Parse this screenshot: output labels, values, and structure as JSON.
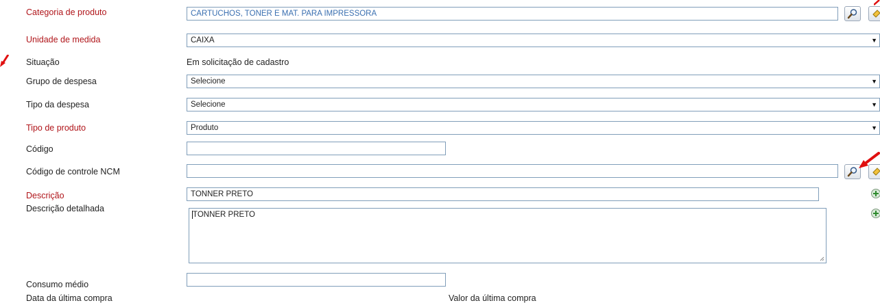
{
  "form": {
    "categoria": {
      "label": "Categoria de produto",
      "value": "CARTUCHOS, TONER E MAT. PARA IMPRESSORA"
    },
    "unidade": {
      "label": "Unidade de medida",
      "value": "CAIXA"
    },
    "situacao": {
      "label": "Situação",
      "value": "Em solicitação de cadastro"
    },
    "grupo": {
      "label": "Grupo de despesa",
      "value": "Selecione"
    },
    "tipo_despesa": {
      "label": "Tipo da despesa",
      "value": "Selecione"
    },
    "tipo_produto": {
      "label": "Tipo de produto",
      "value": "Produto"
    },
    "codigo": {
      "label": "Código",
      "value": ""
    },
    "ncm": {
      "label": "Código de controle NCM",
      "value": ""
    },
    "descricao": {
      "label": "Descrição",
      "value": "TONNER PRETO"
    },
    "descricao_detalhada": {
      "label": "Descrição detalhada",
      "value": "TONNER PRETO"
    },
    "consumo": {
      "label": "Consumo médio",
      "value": ""
    },
    "data_ultima": {
      "label": "Data da última compra"
    },
    "valor_ultima": {
      "label": "Valor da última compra"
    }
  },
  "icons": {
    "search": "magnifier-icon",
    "clear": "eraser-icon",
    "add": "add-icon",
    "annotation": "red-arrow-icon"
  },
  "colors": {
    "required_label": "#b0151a",
    "field_border": "#7f9db9",
    "arrow": "#e01010"
  }
}
